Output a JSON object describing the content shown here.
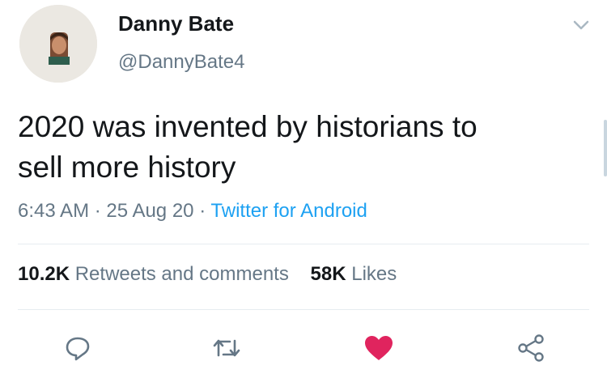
{
  "user": {
    "name": "Danny Bate",
    "handle": "@DannyBate4"
  },
  "tweet": {
    "text_line1": "2020 was invented by historians to",
    "text_line2": "sell more history",
    "time": "6:43 AM",
    "separator": "·",
    "date": "25 Aug 20",
    "source": "Twitter for Android"
  },
  "stats": {
    "retweets_count": "10.2K",
    "retweets_label": "Retweets and comments",
    "likes_count": "58K",
    "likes_label": "Likes"
  },
  "actions": {
    "reply_icon": "reply-icon",
    "retweet_icon": "retweet-icon",
    "like_icon": "heart-icon",
    "share_icon": "share-icon"
  },
  "colors": {
    "text": "#14171a",
    "secondary": "#657786",
    "link": "#1da1f2",
    "like": "#e0245e"
  }
}
